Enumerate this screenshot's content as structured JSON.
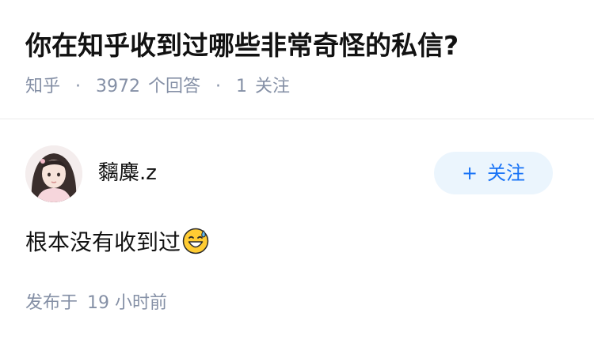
{
  "question": {
    "title": "你在知乎收到过哪些非常奇怪的私信?",
    "source": "知乎",
    "separator": "·",
    "answer_count": "3972",
    "answer_unit": "个回答",
    "follower_count": "1",
    "follower_unit": "关注"
  },
  "author": {
    "name": "黐麋.z",
    "follow_plus": "+",
    "follow_label": "关注"
  },
  "answer": {
    "content": "根本没有收到过",
    "emoji": "sweat-smile-emoji",
    "time_prefix": "发布于",
    "time_value": "19",
    "time_unit": "小时前"
  },
  "colors": {
    "text_primary": "#121212",
    "text_secondary": "#8590a6",
    "accent": "#1772f6",
    "button_bg": "#ebf5fd",
    "divider": "#ebebeb"
  }
}
